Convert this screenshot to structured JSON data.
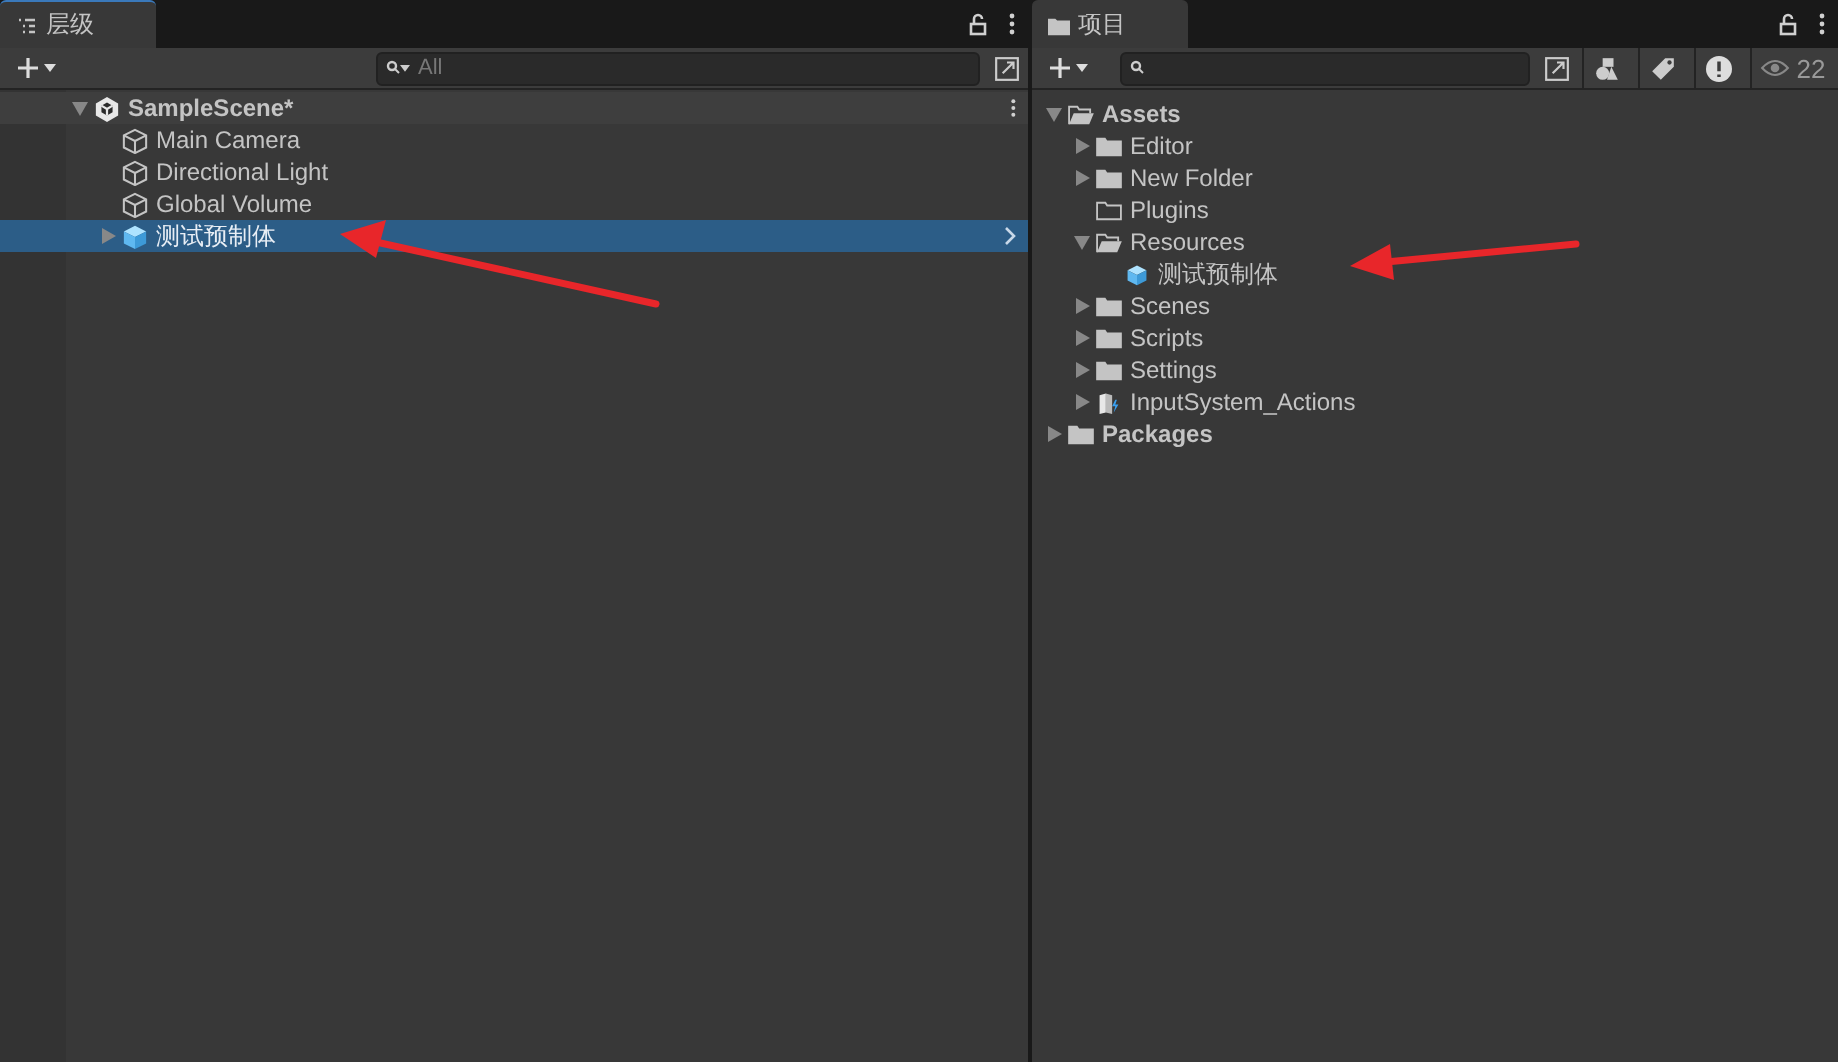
{
  "hierarchy": {
    "tab": {
      "label": "层级"
    },
    "search": {
      "placeholder": "All"
    },
    "tree": [
      {
        "label": "SampleScene*",
        "kind": "scene",
        "expanded": true,
        "selected": false,
        "children": [
          {
            "label": "Main Camera",
            "kind": "gameobject",
            "selected": false
          },
          {
            "label": "Directional Light",
            "kind": "gameobject",
            "selected": false
          },
          {
            "label": "Global Volume",
            "kind": "gameobject",
            "selected": false
          },
          {
            "label": "测试预制体",
            "kind": "prefab",
            "expanded": false,
            "selected": true
          }
        ]
      }
    ]
  },
  "project": {
    "tab": {
      "label": "项目"
    },
    "hidden_count": "22",
    "tree": [
      {
        "label": "Assets",
        "kind": "folder",
        "expanded": true,
        "children": [
          {
            "label": "Editor",
            "kind": "folder",
            "expanded": false
          },
          {
            "label": "New Folder",
            "kind": "folder",
            "expanded": false
          },
          {
            "label": "Plugins",
            "kind": "empty-folder"
          },
          {
            "label": "Resources",
            "kind": "folder",
            "expanded": true,
            "children": [
              {
                "label": "测试预制体",
                "kind": "prefab"
              }
            ]
          },
          {
            "label": "Scenes",
            "kind": "folder",
            "expanded": false
          },
          {
            "label": "Scripts",
            "kind": "folder",
            "expanded": false
          },
          {
            "label": "Settings",
            "kind": "folder",
            "expanded": false
          },
          {
            "label": "InputSystem_Actions",
            "kind": "input-actions",
            "expanded": false
          }
        ]
      },
      {
        "label": "Packages",
        "kind": "folder",
        "expanded": false
      }
    ]
  }
}
